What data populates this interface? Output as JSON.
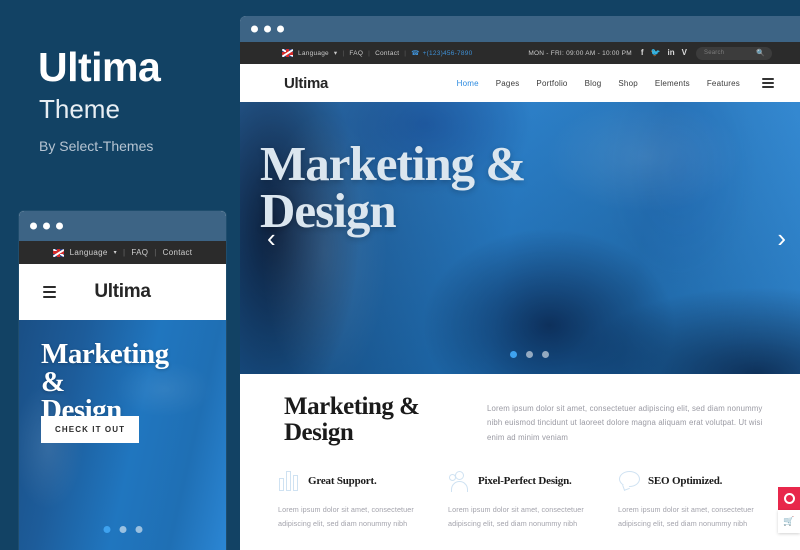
{
  "left": {
    "title": "Ultima",
    "subtitle": "Theme",
    "byline": "By Select-Themes"
  },
  "colors": {
    "page_bg": "#124264",
    "titlebar": "#3d6485",
    "topbar_dark": "#2b2b2b",
    "accent_blue": "#2b8ae0",
    "hero_blue": "#2178c4",
    "widget_red": "#e8274b",
    "icon_outline": "#cfe2f2"
  },
  "mobile": {
    "topstrip": {
      "flag_icon": "uk-flag-icon",
      "language": "Language",
      "chevron": "chevron-down-icon",
      "faq": "FAQ",
      "contact": "Contact"
    },
    "header": {
      "menu_icon": "hamburger-menu-icon",
      "logo": "Ultima"
    },
    "hero": {
      "title_line1": "Marketing",
      "title_line2": "&",
      "title_line3": "Design",
      "cta": "CHECK IT OUT",
      "dots": 3,
      "active_dot": 0
    }
  },
  "desktop": {
    "topbar": {
      "flag_icon": "uk-flag-icon",
      "language": "Language",
      "chevron": "chevron-down-icon",
      "faq": "FAQ",
      "contact": "Contact",
      "phone_icon": "phone-icon",
      "phone": "+(123)456-7890",
      "hours": "MON - FRI: 09:00 AM - 10:00 PM",
      "socials": [
        "facebook-icon",
        "twitter-icon",
        "linkedin-icon",
        "vimeo-icon"
      ],
      "search_placeholder": "Search",
      "search_icon": "search-icon"
    },
    "nav": {
      "logo": "Ultima",
      "items": [
        {
          "label": "Home",
          "active": true
        },
        {
          "label": "Pages",
          "active": false
        },
        {
          "label": "Portfolio",
          "active": false
        },
        {
          "label": "Blog",
          "active": false
        },
        {
          "label": "Shop",
          "active": false
        },
        {
          "label": "Elements",
          "active": false
        },
        {
          "label": "Features",
          "active": false
        }
      ],
      "menu_icon": "hamburger-menu-icon"
    },
    "hero": {
      "title_line1": "Marketing &",
      "title_line2": "Design",
      "prev_icon": "chevron-left-icon",
      "next_icon": "chevron-right-icon",
      "dots": 3,
      "active_dot": 0
    },
    "section": {
      "title_line1": "Marketing &",
      "title_line2": "Design",
      "paragraph": "Lorem ipsum dolor sit amet, consectetuer adipiscing elit, sed diam nonummy nibh euismod tincidunt ut laoreet dolore magna aliquam erat volutpat. Ut wisi enim ad minim veniam"
    },
    "features": [
      {
        "icon": "bar-chart-icon",
        "title": "Great Support.",
        "text": "Lorem ipsum dolor sit amet, consectetuer adipiscing elit, sed diam nonummy nibh"
      },
      {
        "icon": "people-icon",
        "title": "Pixel-Perfect Design.",
        "text": "Lorem ipsum dolor sit amet, consectetuer adipiscing elit, sed diam nonummy nibh"
      },
      {
        "icon": "speech-bubble-icon",
        "title": "SEO Optimized.",
        "text": "Lorem ipsum dolor sit amet, consectetuer adipiscing elit, sed diam nonummy nibh"
      }
    ]
  },
  "widgets": {
    "options_icon": "target-ring-icon",
    "cart_icon": "shopping-cart-icon"
  }
}
